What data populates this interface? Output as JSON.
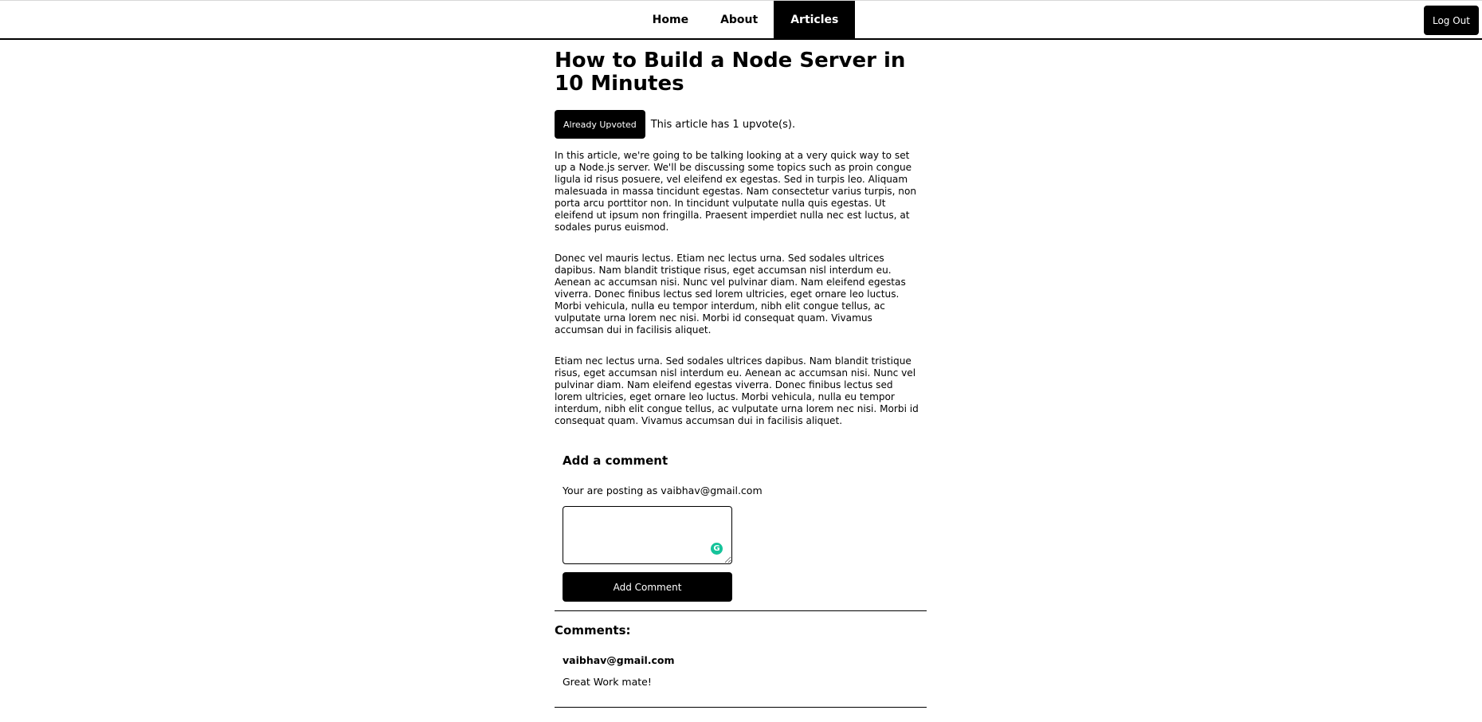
{
  "nav": {
    "links": [
      {
        "label": "Home",
        "active": false
      },
      {
        "label": "About",
        "active": false
      },
      {
        "label": "Articles",
        "active": true
      }
    ],
    "logout_label": "Log Out"
  },
  "article": {
    "title": "How to Build a Node Server in 10 Minutes",
    "upvote_button_label": "Already Upvoted",
    "upvote_text": "This article has 1 upvote(s).",
    "paragraphs": [
      "In this article, we're going to be talking looking at a very quick way to set up a Node.js server. We'll be discussing some topics such as proin congue ligula id risus posuere, vel eleifend ex egestas. Sed in turpis leo. Aliquam malesuada in massa tincidunt egestas. Nam consectetur varius turpis, non porta arcu porttitor non. In tincidunt vulputate nulla quis egestas. Ut eleifend ut ipsum non fringilla. Praesent imperdiet nulla nec est luctus, at sodales purus euismod.",
      "Donec vel mauris lectus. Etiam nec lectus urna. Sed sodales ultrices dapibus. Nam blandit tristique risus, eget accumsan nisl interdum eu. Aenean ac accumsan nisi. Nunc vel pulvinar diam. Nam eleifend egestas viverra. Donec finibus lectus sed lorem ultricies, eget ornare leo luctus. Morbi vehicula, nulla eu tempor interdum, nibh elit congue tellus, ac vulputate urna lorem nec nisi. Morbi id consequat quam. Vivamus accumsan dui in facilisis aliquet.",
      "Etiam nec lectus urna. Sed sodales ultrices dapibus. Nam blandit tristique risus, eget accumsan nisl interdum eu. Aenean ac accumsan nisi. Nunc vel pulvinar diam. Nam eleifend egestas viverra. Donec finibus lectus sed lorem ultricies, eget ornare leo luctus. Morbi vehicula, nulla eu tempor interdum, nibh elit congue tellus, ac vulputate urna lorem nec nisi. Morbi id consequat quam. Vivamus accumsan dui in facilisis aliquet."
    ]
  },
  "comment_form": {
    "title": "Add a comment",
    "posting_as": "Your are posting as vaibhav@gmail.com",
    "textarea_value": "",
    "submit_label": "Add Comment",
    "extension_icon": "grammarly-icon",
    "extension_color": "#15c39a"
  },
  "comments": {
    "heading": "Comments:",
    "items": [
      {
        "author": "vaibhav@gmail.com",
        "text": "Great Work mate!"
      }
    ]
  }
}
